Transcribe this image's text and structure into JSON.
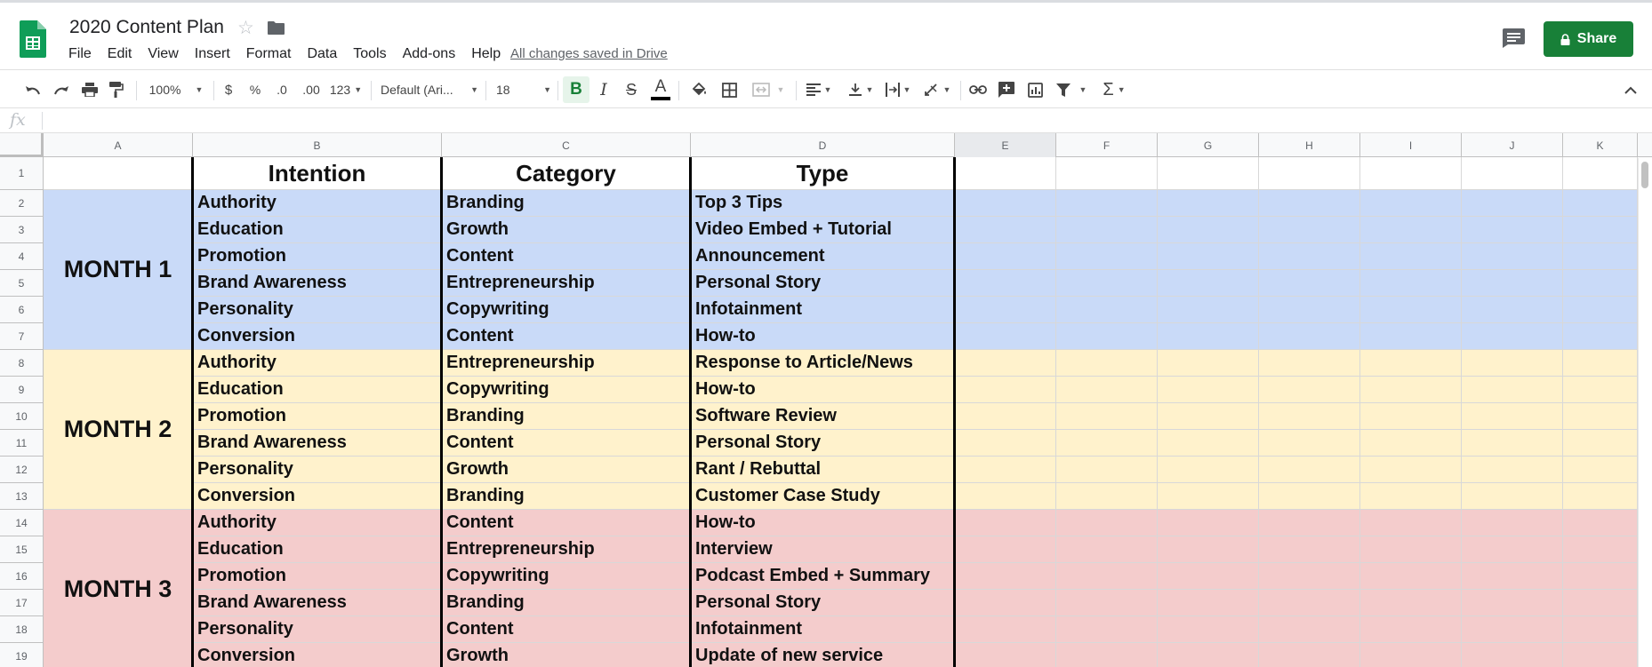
{
  "app": {
    "doc_title": "2020 Content Plan",
    "menu": [
      "File",
      "Edit",
      "View",
      "Insert",
      "Format",
      "Data",
      "Tools",
      "Add-ons",
      "Help"
    ],
    "save_status": "All changes saved in Drive",
    "share_label": "Share",
    "brand_color": "#188038"
  },
  "toolbar": {
    "zoom": "100%",
    "currency": "$",
    "percent": "%",
    "decrease_decimal": ".0",
    "increase_decimal": ".00",
    "more_formats": "123",
    "font": "Default (Ari...",
    "font_size": "18",
    "bold": "B",
    "italic": "I",
    "strikethrough": "S",
    "text_color": "A",
    "icons": [
      "undo-icon",
      "redo-icon",
      "print-icon",
      "paint-format-icon",
      "fill-color-icon",
      "borders-icon",
      "merge-cells-icon",
      "align-left-icon",
      "vertical-align-icon",
      "text-wrap-icon",
      "text-rotation-icon",
      "link-icon",
      "insert-comment-icon",
      "insert-chart-icon",
      "filter-icon",
      "functions-icon",
      "collapse-icon"
    ]
  },
  "formula_bar": {
    "fx": "fx",
    "value": ""
  },
  "sheet": {
    "columns": [
      "A",
      "B",
      "C",
      "D",
      "E",
      "F",
      "G",
      "H",
      "I",
      "J",
      "K"
    ],
    "row_numbers": [
      "1",
      "2",
      "3",
      "4",
      "5",
      "6",
      "7",
      "8",
      "9",
      "10",
      "11",
      "12",
      "13",
      "14",
      "15",
      "16",
      "17",
      "18",
      "19"
    ],
    "headers": {
      "intention": "Intention",
      "category": "Category",
      "type": "Type"
    },
    "months": [
      {
        "label": "MONTH 1",
        "color": "#c9daf8",
        "rows": [
          {
            "intention": "Authority",
            "category": "Branding",
            "type": "Top 3 Tips"
          },
          {
            "intention": "Education",
            "category": "Growth",
            "type": "Video Embed + Tutorial"
          },
          {
            "intention": "Promotion",
            "category": "Content",
            "type": "Announcement"
          },
          {
            "intention": "Brand Awareness",
            "category": "Entrepreneurship",
            "type": "Personal Story"
          },
          {
            "intention": "Personality",
            "category": "Copywriting",
            "type": "Infotainment"
          },
          {
            "intention": "Conversion",
            "category": "Content",
            "type": "How-to"
          }
        ]
      },
      {
        "label": "MONTH 2",
        "color": "#fff2cc",
        "rows": [
          {
            "intention": "Authority",
            "category": "Entrepreneurship",
            "type": "Response to Article/News"
          },
          {
            "intention": "Education",
            "category": "Copywriting",
            "type": "How-to"
          },
          {
            "intention": "Promotion",
            "category": "Branding",
            "type": "Software Review"
          },
          {
            "intention": "Brand Awareness",
            "category": "Content",
            "type": "Personal Story"
          },
          {
            "intention": "Personality",
            "category": "Growth",
            "type": "Rant / Rebuttal"
          },
          {
            "intention": "Conversion",
            "category": "Branding",
            "type": "Customer Case Study"
          }
        ]
      },
      {
        "label": "MONTH 3",
        "color": "#f4cccc",
        "rows": [
          {
            "intention": "Authority",
            "category": "Content",
            "type": "How-to"
          },
          {
            "intention": "Education",
            "category": "Entrepreneurship",
            "type": "Interview"
          },
          {
            "intention": "Promotion",
            "category": "Copywriting",
            "type": "Podcast Embed + Summary"
          },
          {
            "intention": "Brand Awareness",
            "category": "Branding",
            "type": "Personal Story"
          },
          {
            "intention": "Personality",
            "category": "Content",
            "type": "Infotainment"
          },
          {
            "intention": "Conversion",
            "category": "Growth",
            "type": "Update of new service"
          }
        ]
      }
    ]
  }
}
